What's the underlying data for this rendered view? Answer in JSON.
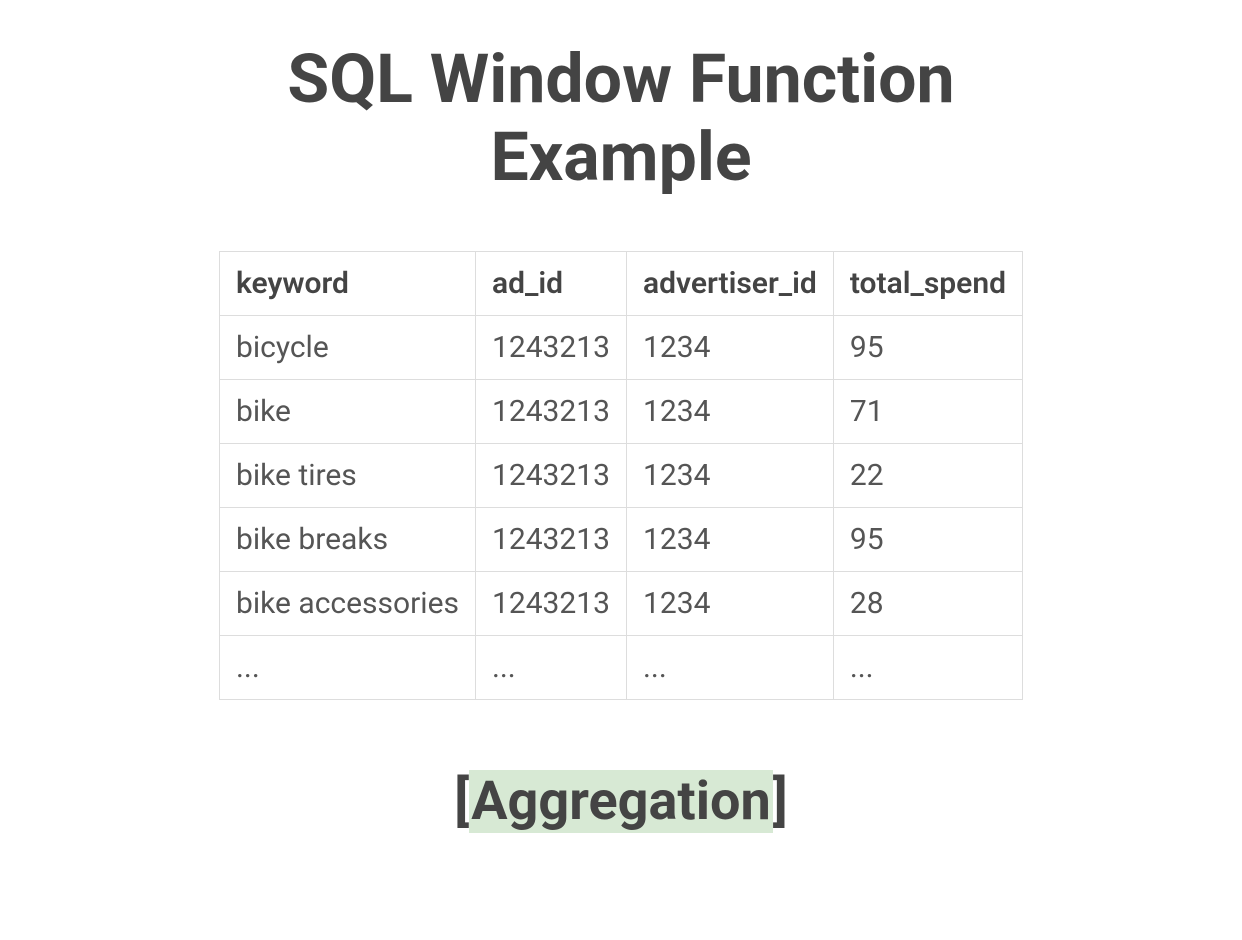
{
  "title": "SQL Window Function Example",
  "table": {
    "headers": [
      "keyword",
      "ad_id",
      "advertiser_id",
      "total_spend"
    ],
    "rows": [
      [
        "bicycle",
        "1243213",
        "1234",
        "95"
      ],
      [
        "bike",
        "1243213",
        "1234",
        "71"
      ],
      [
        "bike tires",
        "1243213",
        "1234",
        "22"
      ],
      [
        "bike breaks",
        "1243213",
        "1234",
        "95"
      ],
      [
        "bike accessories",
        "1243213",
        "1234",
        "28"
      ],
      [
        "...",
        "...",
        "...",
        "..."
      ]
    ]
  },
  "subtitle": {
    "open_bracket": "[",
    "word": "Aggregation",
    "close_bracket": "]"
  }
}
